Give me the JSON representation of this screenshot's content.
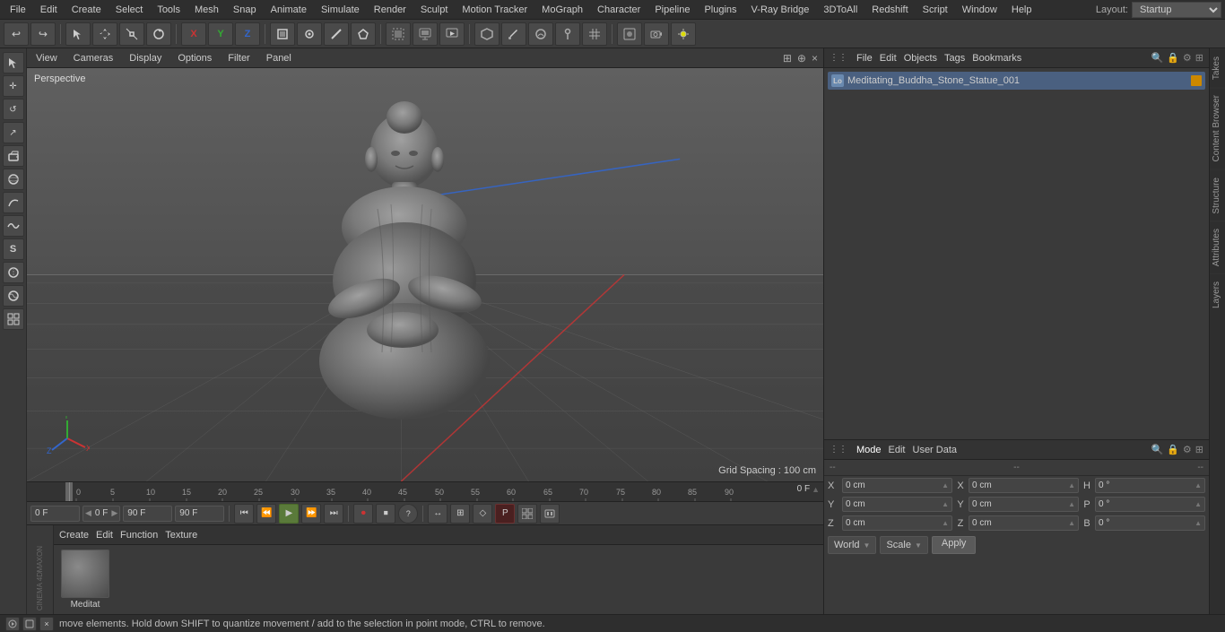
{
  "menubar": {
    "items": [
      "File",
      "Edit",
      "Create",
      "Select",
      "Tools",
      "Mesh",
      "Snap",
      "Animate",
      "Simulate",
      "Render",
      "Sculpt",
      "Motion Tracker",
      "MoGraph",
      "Character",
      "Pipeline",
      "Plugins",
      "V-Ray Bridge",
      "3DToAll",
      "Redshift",
      "Script",
      "Window",
      "Help"
    ],
    "layout_label": "Layout:",
    "layout_value": "Startup"
  },
  "toolbar": {
    "undo_label": "↩",
    "tools": [
      "↩",
      "⊡",
      "✛",
      "↺",
      "↗",
      "X",
      "Y",
      "Z",
      "▣",
      "◎",
      "↻",
      "✦",
      "▷",
      "▽",
      "▻",
      "▪",
      "▼",
      "⊞",
      "⊗",
      "◈",
      "▢",
      "⌂",
      "◉",
      "⊙"
    ]
  },
  "viewport": {
    "tabs": [
      "View",
      "Cameras",
      "Display",
      "Options",
      "Filter",
      "Panel"
    ],
    "perspective_label": "Perspective",
    "grid_spacing": "Grid Spacing : 100 cm"
  },
  "left_tools": {
    "buttons": [
      "▶",
      "⊕",
      "⊞",
      "↕",
      "⊙",
      "⬡",
      "△",
      "⊿",
      "S",
      "⌀",
      "⊗",
      "▣"
    ]
  },
  "objects": {
    "header_items": [
      "File",
      "Edit",
      "Objects",
      "Tags",
      "Bookmarks"
    ],
    "object_name": "Meditating_Buddha_Stone_Statue_001",
    "object_prefix": "Lo"
  },
  "attributes": {
    "header_items": [
      "Mode",
      "Edit",
      "User Data"
    ],
    "rows": [
      {
        "label": "X",
        "val1": "0 cm",
        "lbl2": "X",
        "val2": "0 cm",
        "lbl3": "H",
        "val3": "0 °"
      },
      {
        "label": "Y",
        "val1": "0 cm",
        "lbl2": "Y",
        "val2": "0 cm",
        "lbl3": "P",
        "val3": "0 °"
      },
      {
        "label": "Z",
        "val1": "0 cm",
        "lbl2": "Z",
        "val2": "0 cm",
        "lbl3": "B",
        "val3": "0 °"
      }
    ],
    "world_label": "World",
    "scale_label": "Scale",
    "apply_label": "Apply"
  },
  "timeline": {
    "frame_start": "0 F",
    "frame_end": "90 F",
    "current_frame": "0 F",
    "frame_end2": "90 F",
    "marks": [
      0,
      5,
      10,
      15,
      20,
      25,
      30,
      35,
      40,
      45,
      50,
      55,
      60,
      65,
      70,
      75,
      80,
      85,
      90
    ],
    "current_frame_right": "0 F"
  },
  "material": {
    "header_items": [
      "Create",
      "Edit",
      "Function",
      "Texture"
    ],
    "name": "Meditat"
  },
  "status_bar": {
    "message": "move elements. Hold down SHIFT to quantize movement / add to the selection in point mode, CTRL to remove."
  },
  "right_tabs": [
    "Takes",
    "Content Browser",
    "Structure",
    "Attributes",
    "Layers"
  ],
  "coord_labels": {
    "row1_l1": "X",
    "row1_v1": "0 cm",
    "row1_l2": "X",
    "row1_v2": "0 cm",
    "row1_l3": "H",
    "row1_v3": "0 °",
    "row2_l1": "Y",
    "row2_v1": "0 cm",
    "row2_l2": "Y",
    "row2_v2": "0 cm",
    "row2_l3": "P",
    "row2_v3": "0 °",
    "row3_l1": "Z",
    "row3_v1": "0 cm",
    "row3_l2": "Z",
    "row3_v2": "0 cm",
    "row3_l3": "B",
    "row3_v3": "0 °"
  }
}
